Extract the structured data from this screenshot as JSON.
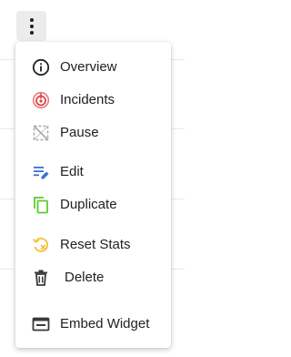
{
  "trigger": {
    "icon": "more-vertical-icon"
  },
  "menu": {
    "items": [
      {
        "key": "overview",
        "label": "Overview",
        "icon": "info-icon",
        "color": "#202124"
      },
      {
        "key": "incidents",
        "label": "Incidents",
        "icon": "incident-icon",
        "color": "#e05d5d"
      },
      {
        "key": "pause",
        "label": "Pause",
        "icon": "pause-icon",
        "color": "#9e9e9e"
      },
      {
        "key": "edit",
        "label": "Edit",
        "icon": "edit-icon",
        "color": "#3b6fd8"
      },
      {
        "key": "duplicate",
        "label": "Duplicate",
        "icon": "duplicate-icon",
        "color": "#5ccc2f"
      },
      {
        "key": "reset",
        "label": "Reset Stats",
        "icon": "reset-stats-icon",
        "color": "#f2c237"
      },
      {
        "key": "delete",
        "label": "Delete",
        "icon": "trash-icon",
        "color": "#3a3a3a"
      },
      {
        "key": "embed",
        "label": "Embed Widget",
        "icon": "embed-widget-icon",
        "color": "#3a3a3a"
      }
    ]
  }
}
